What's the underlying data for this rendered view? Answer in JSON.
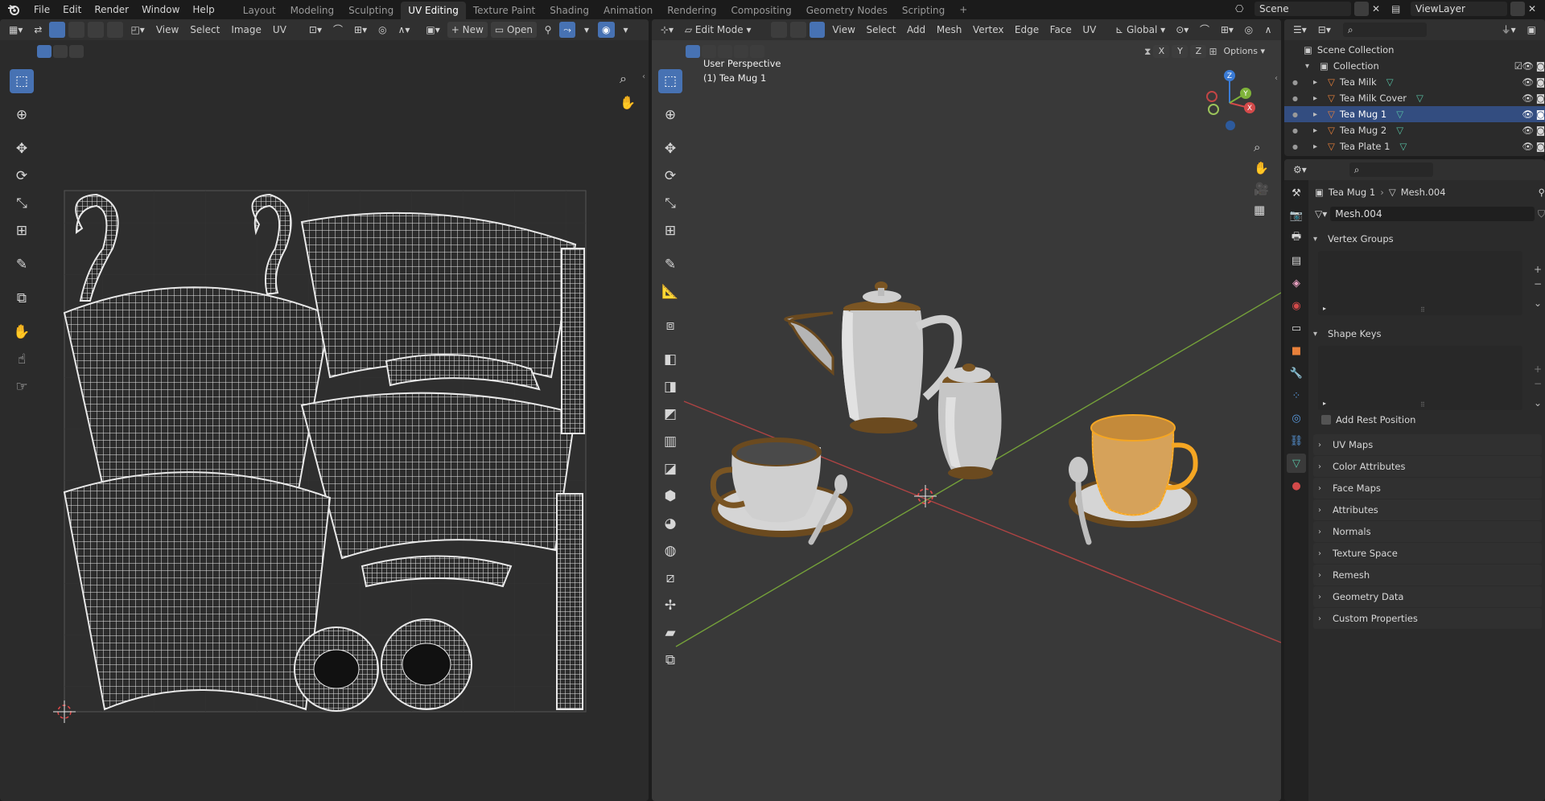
{
  "topbar": {
    "menus": [
      "File",
      "Edit",
      "Render",
      "Window",
      "Help"
    ],
    "workspaces": [
      "Layout",
      "Modeling",
      "Sculpting",
      "UV Editing",
      "Texture Paint",
      "Shading",
      "Animation",
      "Rendering",
      "Compositing",
      "Geometry Nodes",
      "Scripting"
    ],
    "active_workspace": "UV Editing",
    "scene": "Scene",
    "view_layer": "ViewLayer",
    "add_tab": "+"
  },
  "uv_editor": {
    "header": {
      "view": "View",
      "select": "Select",
      "image": "Image",
      "uv": "UV",
      "new_button": "New",
      "open_button": "Open"
    }
  },
  "viewport": {
    "header": {
      "mode": "Edit Mode",
      "view": "View",
      "select": "Select",
      "add": "Add",
      "mesh": "Mesh",
      "vertex": "Vertex",
      "edge": "Edge",
      "face": "Face",
      "uv": "UV",
      "orientation": "Global",
      "options": "Options",
      "x": "X",
      "y": "Y",
      "z": "Z"
    },
    "overlay": {
      "perspective": "User Perspective",
      "object": "(1) Tea Mug 1"
    },
    "gizmo": {
      "x": "X",
      "y": "Y",
      "z": "Z"
    }
  },
  "outliner": {
    "root": "Scene Collection",
    "collection": "Collection",
    "items": [
      {
        "name": "Tea Milk",
        "selected": false
      },
      {
        "name": "Tea Milk Cover",
        "selected": false
      },
      {
        "name": "Tea Mug 1",
        "selected": true
      },
      {
        "name": "Tea Mug 2",
        "selected": false
      },
      {
        "name": "Tea Plate 1",
        "selected": false
      }
    ]
  },
  "properties": {
    "breadcrumb_object": "Tea Mug 1",
    "breadcrumb_mesh": "Mesh.004",
    "mesh_name": "Mesh.004",
    "vertex_groups": "Vertex Groups",
    "shape_keys": "Shape Keys",
    "add_rest_position": "Add Rest Position",
    "panels": [
      "UV Maps",
      "Color Attributes",
      "Face Maps",
      "Attributes",
      "Normals",
      "Texture Space",
      "Remesh",
      "Geometry Data",
      "Custom Properties"
    ]
  },
  "colors": {
    "accent": "#4772b3",
    "selection_orange": "#f5a623",
    "axis_x": "#d44a4a",
    "axis_y": "#7fb33a",
    "axis_z": "#3a7bd5",
    "mesh_icon": "#57c1a4",
    "object_icon": "#e8803a"
  }
}
